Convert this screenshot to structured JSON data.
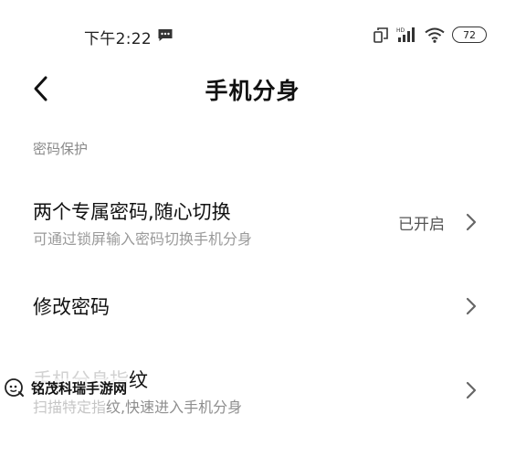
{
  "status_bar": {
    "time": "下午2:22",
    "battery": "72",
    "network_badge": "HD"
  },
  "header": {
    "title": "手机分身"
  },
  "section": {
    "label": "密码保护"
  },
  "rows": {
    "passwords": {
      "title": "两个专属密码,随心切换",
      "subtitle": "可通过锁屏输入密码切换手机分身",
      "value": "已开启"
    },
    "change_password": {
      "title": "修改密码"
    },
    "fingerprint": {
      "title_faded": "手机分身指",
      "title_tail": "纹",
      "subtitle_faded": "扫描特定指",
      "subtitle_tail": "纹,快速进入手机分身"
    }
  },
  "watermark": {
    "text": "铭茂科瑞手游网"
  },
  "colors": {
    "background": "#ffffff",
    "text_primary": "#111111",
    "text_secondary": "#9a9a9a",
    "section_label": "#8a8a8a"
  }
}
